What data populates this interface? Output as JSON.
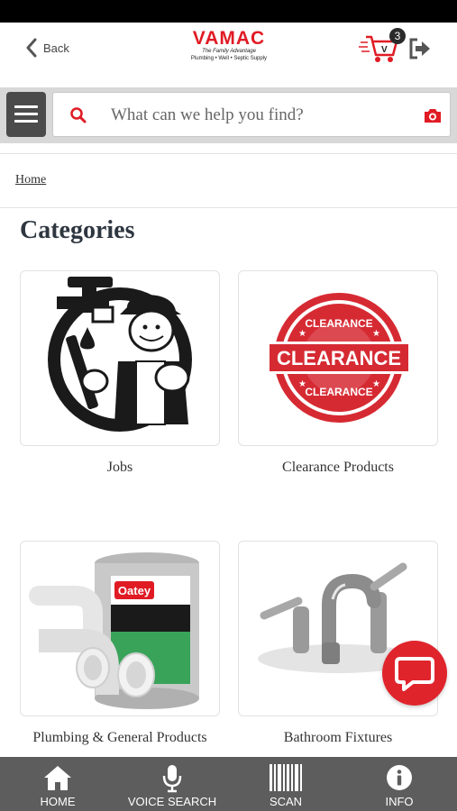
{
  "header": {
    "back_label": "Back",
    "logo": {
      "brand": "VAMAC",
      "tagline": "The Family Advantage",
      "subtitle": "Plumbing • Well • Septic Supply"
    },
    "cart_count": "3"
  },
  "search": {
    "placeholder": "What can we help you find?"
  },
  "breadcrumb": {
    "home": "Home"
  },
  "page_title": "Categories",
  "categories": [
    {
      "label": "Jobs",
      "image": "plumber-mascot"
    },
    {
      "label": "Clearance Products",
      "image": "clearance-stamp"
    },
    {
      "label": "Plumbing & General Products",
      "image": "pvc-cement-fittings"
    },
    {
      "label": "Bathroom Fixtures",
      "image": "chrome-faucet"
    }
  ],
  "tabbar": {
    "items": [
      {
        "label": "HOME",
        "icon": "home-icon"
      },
      {
        "label": "VOICE SEARCH",
        "icon": "microphone-icon"
      },
      {
        "label": "SCAN",
        "icon": "barcode-icon"
      },
      {
        "label": "INFO",
        "icon": "info-icon"
      }
    ]
  },
  "colors": {
    "brand_red": "#e01b24",
    "tabbar_bg": "#5d5d5d",
    "menu_bg": "#4b4b4b",
    "title_color": "#2e3640"
  }
}
